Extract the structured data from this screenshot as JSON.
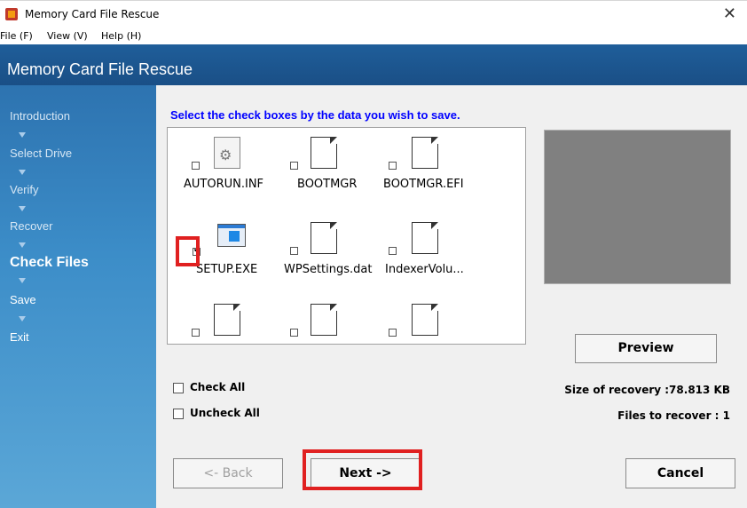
{
  "window": {
    "title": "Memory Card File Rescue",
    "close_glyph": "✕"
  },
  "menu": [
    "File (F)",
    "View (V)",
    "Help (H)"
  ],
  "banner": {
    "title": "Memory Card File Rescue"
  },
  "steps": [
    "Introduction",
    "Select Drive",
    "Verify",
    "Recover",
    "Check Files",
    "Save",
    "Exit"
  ],
  "active_step": "Check Files",
  "instruction": "Select the check boxes by the data you wish to save.",
  "files": [
    {
      "name": "AUTORUN.INF",
      "checked": false,
      "icon": "settings-file-icon"
    },
    {
      "name": "BOOTMGR",
      "checked": false,
      "icon": "document-icon"
    },
    {
      "name": "BOOTMGR.EFI",
      "checked": false,
      "icon": "document-icon"
    },
    {
      "name": "SETUP.EXE",
      "checked": true,
      "icon": "executable-icon"
    },
    {
      "name": "WPSettings.dat",
      "checked": false,
      "icon": "document-icon"
    },
    {
      "name": "IndexerVolu...",
      "checked": false,
      "icon": "document-icon"
    },
    {
      "name": "",
      "checked": false,
      "icon": "document-icon"
    },
    {
      "name": "",
      "checked": false,
      "icon": "document-icon"
    },
    {
      "name": "",
      "checked": false,
      "icon": "document-icon"
    }
  ],
  "buttons": {
    "preview": "Preview",
    "back": "<- Back",
    "next": "Next ->",
    "cancel": "Cancel"
  },
  "options": {
    "check_all": "Check All",
    "uncheck_all": "Uncheck All"
  },
  "info": {
    "size": "Size of recovery :78.813 KB",
    "files": "Files to recover : 1"
  },
  "colors": {
    "banner": "#1f5e9a",
    "sidebar": "#3c8dc8",
    "highlight": "#e02020",
    "instruction": "#0000ff"
  }
}
